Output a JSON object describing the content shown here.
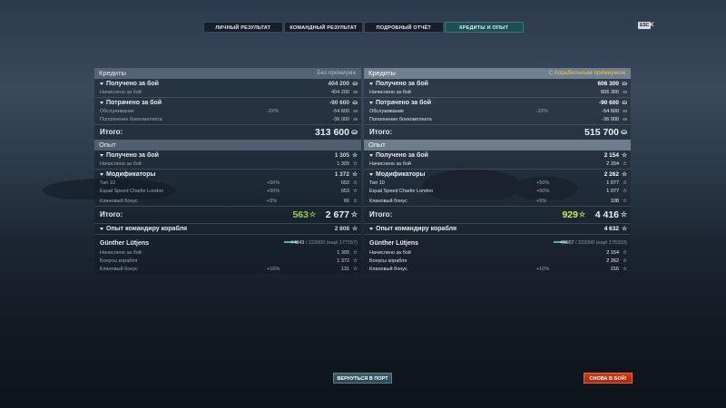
{
  "tabs": [
    "ЛИЧНЫЙ РЕЗУЛЬТАТ",
    "КОМАНДНЫЙ РЕЗУЛЬТАТ",
    "ПОДРОБНЫЙ ОТЧЁТ",
    "КРЕДИТЫ И ОПЫТ"
  ],
  "esc_label": "ESC",
  "close_label": "✕",
  "left": {
    "credits_title": "Кредиты",
    "credits_tag": "Без премиума",
    "earned_label": "Получено за бой",
    "earned_value": "404 200",
    "accrued_label": "Начислено за бой",
    "accrued_value": "404 200",
    "spent_label": "Потрачено за бой",
    "spent_value": "-90 600",
    "service_label": "Обслуживание",
    "service_pct": "-22%",
    "service_value": "-54 600",
    "resupply_label": "Пополнение боекомплекта",
    "resupply_value": "-36 000",
    "total_label": "Итого:",
    "total_value": "313 600",
    "exp_title": "Опыт",
    "exp_earned_label": "Получено за бой",
    "exp_earned_value": "1 305",
    "exp_accrued_label": "Начислено за бой",
    "exp_accrued_value": "1 305",
    "mods_label": "Модификаторы",
    "mods_value": "1 372",
    "tier_label": "Тип 10",
    "tier_pct": "+50%",
    "tier_value": "653",
    "flag_label": "Equal Speed Charlie London",
    "flag_pct": "+50%",
    "flag_value": "653",
    "clan_label": "Клановый бонус",
    "clan_pct": "+5%",
    "clan_value": "66",
    "exp_total_label": "Итого:",
    "exp_total_free": "563",
    "exp_total_value": "2 677",
    "cmdr_exp_label": "Опыт командиру корабля",
    "cmdr_exp_value": "2 808",
    "cmdr_name": "Günther Lütjens",
    "cmdr_xp_cur": "44843",
    "cmdr_xp_rest": " / 222000 (ещё 177157)",
    "c_accrued_label": "Начислено за бой",
    "c_accrued_value": "1 305",
    "c_ship_label": "Бонусы корабля",
    "c_ship_value": "1 372",
    "c_clan_label": "Клановый бонус",
    "c_clan_pct": "+10%",
    "c_clan_value": "131"
  },
  "right": {
    "credits_title": "Кредиты",
    "credits_tag": "С Корабельным премиумом",
    "earned_label": "Получено за бой",
    "earned_value": "606 300",
    "accrued_label": "Начислено за бой",
    "accrued_value": "606 300",
    "spent_label": "Потрачено за бой",
    "spent_value": "-90 600",
    "service_label": "Обслуживание",
    "service_pct": "-22%",
    "service_value": "-54 600",
    "resupply_label": "Пополнение боекомплекта",
    "resupply_value": "-36 000",
    "total_label": "Итого:",
    "total_value": "515 700",
    "exp_title": "Опыт",
    "exp_earned_label": "Получено за бой",
    "exp_earned_value": "2 154",
    "exp_accrued_label": "Начислено за бой",
    "exp_accrued_value": "2 154",
    "mods_label": "Модификаторы",
    "mods_value": "2 262",
    "tier_label": "Тип 10",
    "tier_pct": "+50%",
    "tier_value": "1 077",
    "flag_label": "Equal Speed Charlie London",
    "flag_pct": "+50%",
    "flag_value": "1 077",
    "clan_label": "Клановый бонус",
    "clan_pct": "+5%",
    "clan_value": "108",
    "exp_total_label": "Итого:",
    "exp_total_free": "929",
    "exp_total_value": "4 416",
    "cmdr_exp_label": "Опыт командиру корабля",
    "cmdr_exp_value": "4 632",
    "cmdr_name": "Günther Lütjens",
    "cmdr_xp_cur": "46667",
    "cmdr_xp_rest": " / 222000 (ещё 175333)",
    "c_accrued_label": "Начислено за бой",
    "c_accrued_value": "2 154",
    "c_ship_label": "Бонусы корабля",
    "c_ship_value": "2 262",
    "c_clan_label": "Клановый бонус",
    "c_clan_pct": "+10%",
    "c_clan_value": "216"
  },
  "buttons": {
    "port": "ВЕРНУТЬСЯ В ПОРТ",
    "battle": "СНОВА В БОЙ!"
  },
  "icons": {
    "credits": "credits-icon",
    "xp": "star-icon"
  }
}
